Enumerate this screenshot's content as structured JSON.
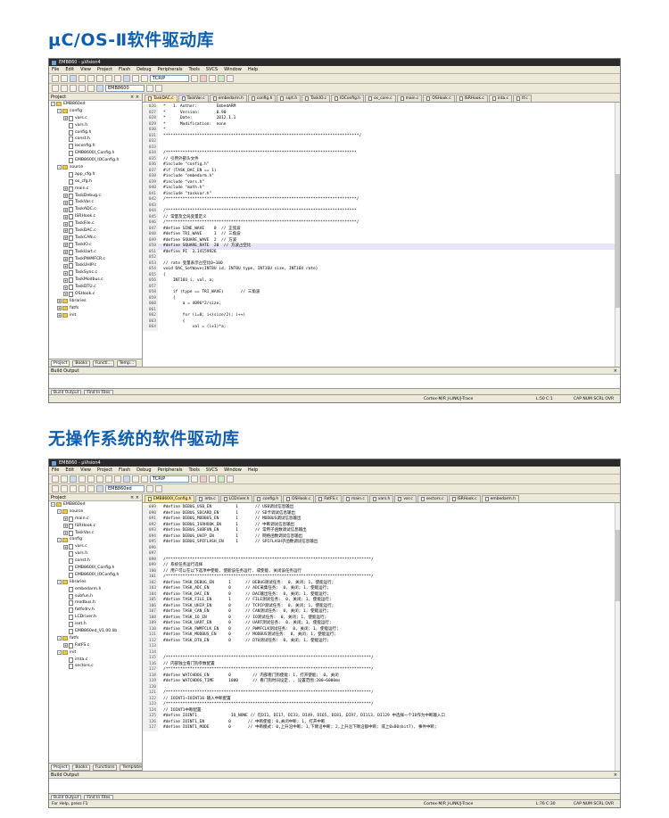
{
  "section1": {
    "heading": "μC/OS-Ⅱ软件驱动库",
    "window_title": "EMB860 - µVision4",
    "menu": [
      "File",
      "Edit",
      "View",
      "Project",
      "Flash",
      "Debug",
      "Peripherals",
      "Tools",
      "SVCS",
      "Window",
      "Help"
    ],
    "target_combo": "EMB8600",
    "search_combo": "TCRIP",
    "panel_head": "Project",
    "tree": [
      {
        "indent": 0,
        "exp": "-",
        "type": "fold",
        "label": "EMB860ed"
      },
      {
        "indent": 1,
        "exp": "-",
        "type": "fold",
        "label": "config"
      },
      {
        "indent": 2,
        "exp": "+",
        "type": "file",
        "label": "vars.c"
      },
      {
        "indent": 2,
        "exp": "",
        "type": "file",
        "label": "vars.h"
      },
      {
        "indent": 2,
        "exp": "",
        "type": "file",
        "label": "config.h"
      },
      {
        "indent": 2,
        "exp": "",
        "type": "file",
        "label": "const.h"
      },
      {
        "indent": 2,
        "exp": "",
        "type": "file",
        "label": "ioconfig.h"
      },
      {
        "indent": 2,
        "exp": "",
        "type": "file",
        "label": "EMB8600l_Config.h"
      },
      {
        "indent": 2,
        "exp": "",
        "type": "file",
        "label": "EMB8600l_IOConfig.h"
      },
      {
        "indent": 1,
        "exp": "-",
        "type": "fold",
        "label": "source"
      },
      {
        "indent": 2,
        "exp": "",
        "type": "file",
        "label": "app_cfg.h"
      },
      {
        "indent": 2,
        "exp": "",
        "type": "file",
        "label": "os_cfg.h"
      },
      {
        "indent": 2,
        "exp": "+",
        "type": "file",
        "label": "main.c"
      },
      {
        "indent": 2,
        "exp": "+",
        "type": "file",
        "label": "TaskDebug.c"
      },
      {
        "indent": 2,
        "exp": "+",
        "type": "file",
        "label": "TaskVar.c"
      },
      {
        "indent": 2,
        "exp": "+",
        "type": "file",
        "label": "TaskADC.c"
      },
      {
        "indent": 2,
        "exp": "+",
        "type": "file",
        "label": "ISRHook.c"
      },
      {
        "indent": 2,
        "exp": "+",
        "type": "file",
        "label": "TaskFile.c"
      },
      {
        "indent": 2,
        "exp": "+",
        "type": "file",
        "label": "TaskDAC.c"
      },
      {
        "indent": 2,
        "exp": "+",
        "type": "file",
        "label": "TaskCAN.c"
      },
      {
        "indent": 2,
        "exp": "+",
        "type": "file",
        "label": "TaskIO.c"
      },
      {
        "indent": 2,
        "exp": "+",
        "type": "file",
        "label": "TaskUart.c"
      },
      {
        "indent": 2,
        "exp": "+",
        "type": "file",
        "label": "TaskPWMFCR.c"
      },
      {
        "indent": 2,
        "exp": "+",
        "type": "file",
        "label": "TaskUHIP.c"
      },
      {
        "indent": 2,
        "exp": "+",
        "type": "file",
        "label": "TaskSync.c"
      },
      {
        "indent": 2,
        "exp": "+",
        "type": "file",
        "label": "TaskModbus.c"
      },
      {
        "indent": 2,
        "exp": "+",
        "type": "file",
        "label": "TaskDTU.c"
      },
      {
        "indent": 2,
        "exp": "+",
        "type": "file",
        "label": "OSHook.c"
      },
      {
        "indent": 1,
        "exp": "+",
        "type": "fold",
        "label": "libraries"
      },
      {
        "indent": 1,
        "exp": "+",
        "type": "fold",
        "label": "fatfs"
      },
      {
        "indent": 1,
        "exp": "+",
        "type": "fold",
        "label": "init"
      }
    ],
    "proj_tabs": [
      "Project",
      "Books",
      "Functi...",
      "Temp..."
    ],
    "tabs": [
      "TaskDAC.c",
      "TaskVar.c",
      "embedarm.h",
      "config.h",
      "sqrt.h",
      "TaskIO.c",
      "IOConfig.h",
      "os_core.c",
      "main.c",
      "OSHook.c",
      "ISRHook.c",
      "inta.c",
      "tf.c"
    ],
    "code": [
      {
        "n": "026",
        "t": "*   1. Author:        EmbedARM",
        "c": "cmt"
      },
      {
        "n": "027",
        "t": "*      Version:       0.90",
        "c": "cmt"
      },
      {
        "n": "028",
        "t": "*      Date:          2012.1.1",
        "c": "cmt"
      },
      {
        "n": "029",
        "t": "*      Modification:  none",
        "c": "cmt"
      },
      {
        "n": "030",
        "t": "*",
        "c": "cmt"
      },
      {
        "n": "031",
        "t": "*********************************************************************************/",
        "c": "cmt"
      },
      {
        "n": "032",
        "t": "",
        "c": ""
      },
      {
        "n": "033",
        "t": "",
        "c": ""
      },
      {
        "n": "034",
        "t": "/*******************************************************************************",
        "c": "cmt"
      },
      {
        "n": "035",
        "t": "// 引用外部头文件",
        "c": "cmt"
      },
      {
        "n": "036",
        "t": "#include \"config.h\"",
        "c": "kw"
      },
      {
        "n": "037",
        "t": "#if (TASK_DAC_EN == 1)",
        "c": "kw"
      },
      {
        "n": "038",
        "t": "#include \"embedarm.h\"",
        "c": "kw"
      },
      {
        "n": "039",
        "t": "#include \"vars.h\"",
        "c": "kw"
      },
      {
        "n": "040",
        "t": "#include \"math.h\"",
        "c": "kw"
      },
      {
        "n": "041",
        "t": "#include \"taskvar.h\"",
        "c": "kw"
      },
      {
        "n": "042",
        "t": "/*******************************************************************************/",
        "c": "cmt"
      },
      {
        "n": "043",
        "t": "",
        "c": ""
      },
      {
        "n": "044",
        "t": "/*******************************************************************************",
        "c": "cmt"
      },
      {
        "n": "045",
        "t": "// 常量及全局变量定义",
        "c": "cmt"
      },
      {
        "n": "046",
        "t": "/*******************************************************************************/",
        "c": "cmt"
      },
      {
        "n": "047",
        "t": "#define SINE_WAVE    0  // 正弦波",
        "c": "kw"
      },
      {
        "n": "048",
        "t": "#define TRI_WAVE     1  // 三角波",
        "c": "kw"
      },
      {
        "n": "049",
        "t": "#define SQUARE_WAVE  2  // 方波",
        "c": "kw"
      },
      {
        "n": "050",
        "t": "#define SQUARE_RATE  20  // 方波占空比",
        "c": "kw",
        "hl": true
      },
      {
        "n": "051",
        "t": "#define PI  3.14159926",
        "c": "kw"
      },
      {
        "n": "052",
        "t": "",
        "c": ""
      },
      {
        "n": "053",
        "t": "// rate 变量表示占空比0~100",
        "c": "cmt"
      },
      {
        "n": "054",
        "t": "void DAC_SetWave(INT8U id, INT8U type, INT16U size, INT16U rate)",
        "c": ""
      },
      {
        "n": "055",
        "t": "{",
        "c": ""
      },
      {
        "n": "056",
        "t": "    INT16U i, val, a;",
        "c": ""
      },
      {
        "n": "057",
        "t": "",
        "c": ""
      },
      {
        "n": "058",
        "t": "    if (type == TRI_WAVE)       // 三角波",
        "c": ""
      },
      {
        "n": "059",
        "t": "    {",
        "c": ""
      },
      {
        "n": "060",
        "t": "        a = 4096*2/size;",
        "c": ""
      },
      {
        "n": "061",
        "t": "",
        "c": ""
      },
      {
        "n": "062",
        "t": "        for (i=0; i<(size/2); i++)",
        "c": ""
      },
      {
        "n": "063",
        "t": "        {",
        "c": ""
      },
      {
        "n": "064",
        "t": "            val = (i+1)*a;",
        "c": ""
      }
    ],
    "build_head": "Build Output",
    "build_tabs": [
      "Build Output",
      "Find In Files"
    ],
    "status_mid": "Cortex-M/R J-LINK/J-Trace",
    "status_pos": "L:50 C:1",
    "status_caps": "CAP  NUM  SCRL  OVR  R/W"
  },
  "section2": {
    "heading": "无操作系统的软件驱动库",
    "window_title": "EMB860 - µVision4",
    "menu": [
      "File",
      "Edit",
      "View",
      "Project",
      "Flash",
      "Debug",
      "Peripherals",
      "Tools",
      "SVCS",
      "Window",
      "Help"
    ],
    "target_combo": "EMB860ed",
    "search_combo": "TCRIP",
    "panel_head": "Project",
    "tree": [
      {
        "indent": 0,
        "exp": "-",
        "type": "fold",
        "label": "EMB860ed"
      },
      {
        "indent": 1,
        "exp": "-",
        "type": "fold",
        "label": "source"
      },
      {
        "indent": 2,
        "exp": "+",
        "type": "file",
        "label": "main.c"
      },
      {
        "indent": 2,
        "exp": "+",
        "type": "file",
        "label": "ISRHook.c"
      },
      {
        "indent": 2,
        "exp": "+",
        "type": "file",
        "label": "TaskVar.c"
      },
      {
        "indent": 1,
        "exp": "-",
        "type": "fold",
        "label": "config"
      },
      {
        "indent": 2,
        "exp": "+",
        "type": "file",
        "label": "vars.c"
      },
      {
        "indent": 2,
        "exp": "",
        "type": "file",
        "label": "vars.h"
      },
      {
        "indent": 2,
        "exp": "",
        "type": "file",
        "label": "const.h"
      },
      {
        "indent": 2,
        "exp": "",
        "type": "file",
        "label": "EMB8600l_Config.h"
      },
      {
        "indent": 2,
        "exp": "",
        "type": "file",
        "label": "EMB8600l_IOConfig.h"
      },
      {
        "indent": 1,
        "exp": "-",
        "type": "fold",
        "label": "libraries"
      },
      {
        "indent": 2,
        "exp": "",
        "type": "file",
        "label": "embedarm.h"
      },
      {
        "indent": 2,
        "exp": "",
        "type": "file",
        "label": "subfun.h"
      },
      {
        "indent": 2,
        "exp": "",
        "type": "file",
        "label": "modbus.h"
      },
      {
        "indent": 2,
        "exp": "",
        "type": "file",
        "label": "fatfsdrv.h"
      },
      {
        "indent": 2,
        "exp": "",
        "type": "file",
        "label": "LCDriver.h"
      },
      {
        "indent": 2,
        "exp": "",
        "type": "file",
        "label": "iset.h"
      },
      {
        "indent": 2,
        "exp": "",
        "type": "file",
        "label": "EMB860ed_V1.00.lib"
      },
      {
        "indent": 1,
        "exp": "-",
        "type": "fold",
        "label": "fatfs"
      },
      {
        "indent": 2,
        "exp": "+",
        "type": "file",
        "label": "FatFS.c"
      },
      {
        "indent": 1,
        "exp": "-",
        "type": "fold",
        "label": "init"
      },
      {
        "indent": 2,
        "exp": "",
        "type": "file",
        "label": "imta.c"
      },
      {
        "indent": 2,
        "exp": "",
        "type": "file",
        "label": "sectors.c"
      }
    ],
    "proj_tabs": [
      "Project",
      "Books",
      "Functions",
      "Templates"
    ],
    "tabs": [
      "EMB8600l_Config.h",
      "inta.c",
      "LCDriver.h",
      "config.h",
      "OSHook.c",
      "FatFS.c",
      "main.c",
      "vars.h",
      "var.c",
      "sectors.c",
      "ISRHook.c",
      "embedarm.h"
    ],
    "code": [
      {
        "n": "089",
        "t": "#define DEBUG_USB_EN          1       // USB调试信息输出",
        "c": "kw"
      },
      {
        "n": "090",
        "t": "#define DEBUG_SDCARD_EN       1       // SD卡调试信息输出",
        "c": "kw"
      },
      {
        "n": "091",
        "t": "#define DEBUG_MODBUS_EN       1       // MODBUS调试信息输出",
        "c": "kw"
      },
      {
        "n": "092",
        "t": "#define DEBUG_ISRHOOK_EN      1       // 中断调试信息输出",
        "c": "kw"
      },
      {
        "n": "093",
        "t": "#define DEBUG_SUBFUN_EN       1       // 常用子函数调试信息输出",
        "c": "kw"
      },
      {
        "n": "094",
        "t": "#define DEBUG_UHIP_EN         1       // 网络函数调试信息输出",
        "c": "kw"
      },
      {
        "n": "095",
        "t": "#define DEBUG_SPIFLASH_EN     1       // SPIFLASH子函数调试信息输出",
        "c": "kw"
      },
      {
        "n": "096",
        "t": "",
        "c": ""
      },
      {
        "n": "097",
        "t": "",
        "c": ""
      },
      {
        "n": "098",
        "t": "/*************************************************************************************/",
        "c": "cmt"
      },
      {
        "n": "099",
        "t": "// 系统任务运行选择",
        "c": "cmt"
      },
      {
        "n": "100",
        "t": "// 用户可以在以下选项中使能, 使能该任务运行, 或使能, 关闭该任务运行",
        "c": "cmt"
      },
      {
        "n": "101",
        "t": "/*************************************************************************************/",
        "c": "cmt"
      },
      {
        "n": "102",
        "t": "#define TASK_DEBUG_EN      1      // DEBUG调试任务:  0, 关闭; 1, 使能运行;",
        "c": "kw"
      },
      {
        "n": "103",
        "t": "#define TASK_ADC_EN        0      // ADC采集任务:  0, 关闭; 1, 使能运行;",
        "c": "kw"
      },
      {
        "n": "104",
        "t": "#define TASK_DAC_EN        0      // DAC输出任务:  0, 关闭; 1, 使能运行;",
        "c": "kw"
      },
      {
        "n": "105",
        "t": "#define TASK_FILE_EN       1      // FILE测试任务:  0, 关闭; 1, 使能运行;",
        "c": "kw"
      },
      {
        "n": "106",
        "t": "#define TASK_UHIP_EN       0      // TCPIP测试任务:  0, 关闭; 1, 使能运行;",
        "c": "kw"
      },
      {
        "n": "107",
        "t": "#define TASK_CAN_EN        0      // CAN测试任务:  0, 关闭; 1, 使能运行;",
        "c": "kw"
      },
      {
        "n": "108",
        "t": "#define TASK_IO_EN         0      // IO测试任务:  0, 关闭; 1, 使能运行;",
        "c": "kw"
      },
      {
        "n": "109",
        "t": "#define TASK_UART_EN       0      // UART测试任务:  0, 关闭; 1, 使能运行;",
        "c": "kw"
      },
      {
        "n": "110",
        "t": "#define TASK_PWMFCLK_EN    0      // PWMFCLK测试任务:  0, 关闭; 1, 使能运行;",
        "c": "kw"
      },
      {
        "n": "111",
        "t": "#define TASK_MODBUS_EN     0      // MODBUS测试任务:  0, 关闭; 1, 使能运行;",
        "c": "kw"
      },
      {
        "n": "112",
        "t": "#define TASK_DTU_EN        0      // DTU测试任务:  0, 关闭; 1, 使能运行;",
        "c": "kw"
      },
      {
        "n": "113",
        "t": "",
        "c": ""
      },
      {
        "n": "114",
        "t": "",
        "c": ""
      },
      {
        "n": "115",
        "t": "/*************************************************************************************/",
        "c": "cmt"
      },
      {
        "n": "116",
        "t": "// 内部独立看门狗参数配置",
        "c": "cmt"
      },
      {
        "n": "117",
        "t": "/*************************************************************************************/",
        "c": "cmt"
      },
      {
        "n": "118",
        "t": "#define WATCHDOG_EN        0         // 内部看门狗使能: 1, 打开使能;  0, 关闭",
        "c": "kw"
      },
      {
        "n": "119",
        "t": "#define WATCHDOG_TIME      1000      // 看门狗时间设定, , 设置范围:200~6000ms",
        "c": "kw"
      },
      {
        "n": "120",
        "t": "",
        "c": ""
      },
      {
        "n": "121",
        "t": "/*************************************************************************************/",
        "c": "cmt"
      },
      {
        "n": "122",
        "t": "// IOINT1~IOINT16 输入中断配置",
        "c": "cmt"
      },
      {
        "n": "123",
        "t": "/*************************************************************************************/",
        "c": "cmt"
      },
      {
        "n": "124",
        "t": "// IOINT1中断配置",
        "c": "cmt"
      },
      {
        "n": "125",
        "t": "#define IOINT1              IO_NONE // 在DI1, DI17, DI33, DI49, DI65, DI81, DI97, DI113, DI129 中选择一个IO作为中断输入口",
        "c": "kw"
      },
      {
        "n": "126",
        "t": "#define IOINT1_EN          0       // 中断使能: 0,关闭中断; 1, 打开中断",
        "c": "kw"
      },
      {
        "n": "127",
        "t": "#define IOINT1_MODE        0       // 中断模式: 0,上升沿中断; 1,下降沿中断; 2,上升沿下降沿都中断; 或上0x80(bit7), 事件中断;",
        "c": "kw"
      }
    ],
    "build_head": "Build Output",
    "build_tabs": [
      "Build Output",
      "Find In Files"
    ],
    "status_left": "For Help, press F1",
    "status_mid": "Cortex-M/R J-LINK/J-Trace",
    "status_pos": "L:76 C:30",
    "status_caps": "CAP  NUM  SCRL  OVR  R/W"
  },
  "colors": {
    "heading": "#0f5eb0",
    "active_tab": "#fbe8a8",
    "comment": "#008000",
    "keyword": "#0000c8"
  },
  "icons": [
    "app-icon",
    "folder-icon",
    "file-icon",
    "new-file-icon",
    "open-icon",
    "save-icon",
    "cut-icon",
    "copy-icon",
    "paste-icon",
    "undo-icon",
    "redo-icon",
    "build-icon",
    "rebuild-icon",
    "debug-icon",
    "search-icon",
    "settings-icon"
  ]
}
